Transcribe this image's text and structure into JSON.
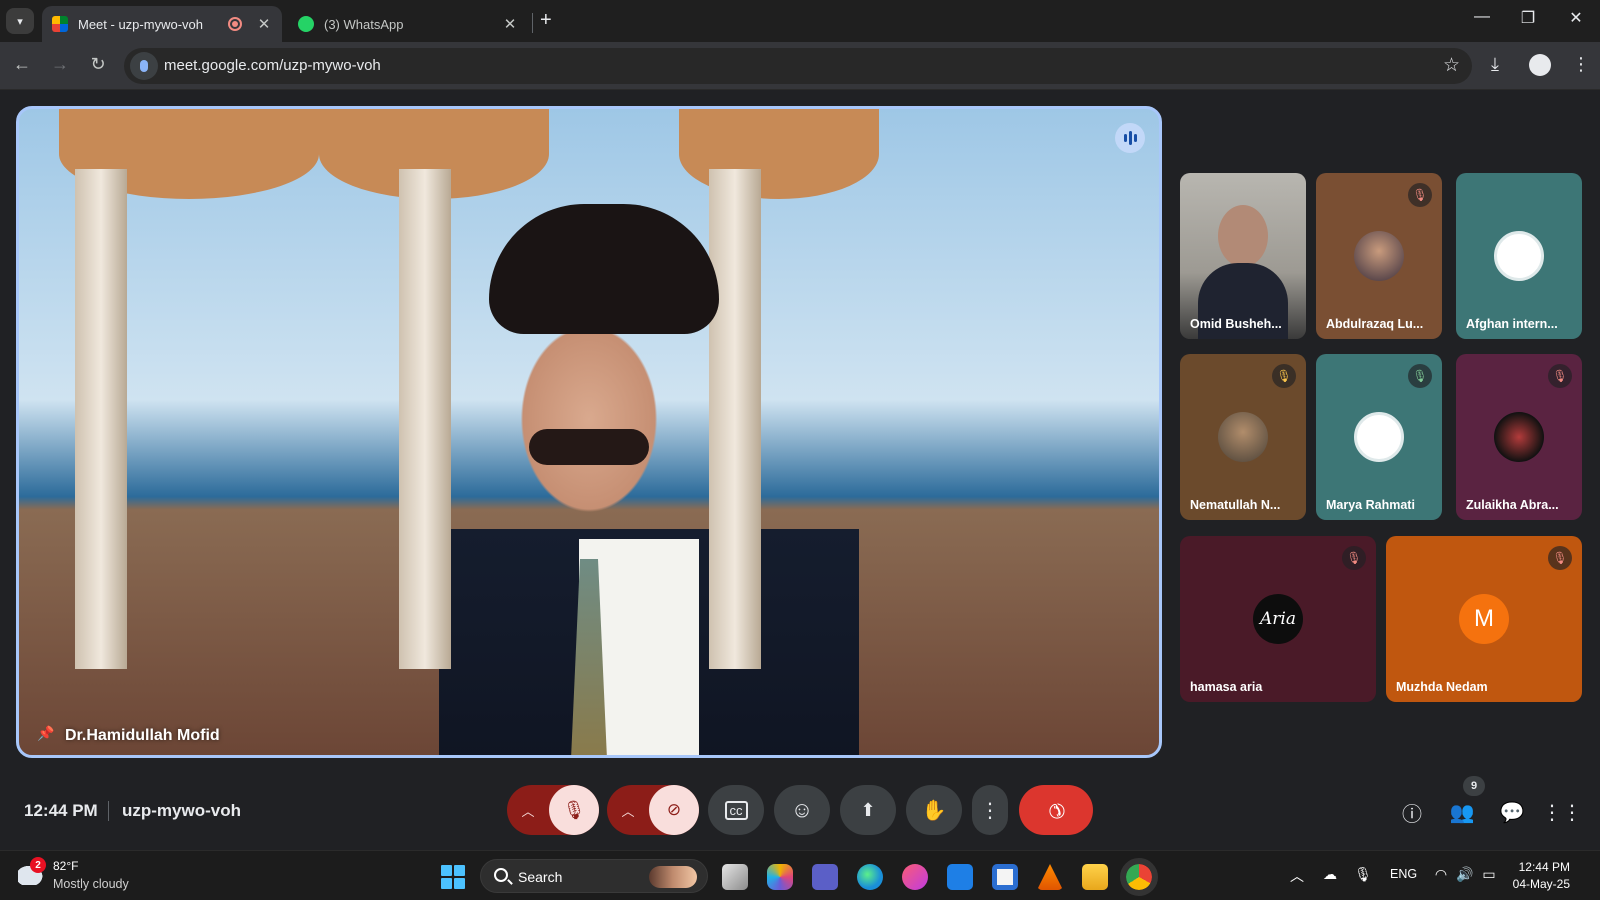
{
  "browser": {
    "tabs": [
      {
        "label": "Meet - uzp-mywo-voh",
        "active": true,
        "recording": true
      },
      {
        "label": "(3) WhatsApp",
        "active": false
      }
    ],
    "new_tab": "+",
    "url": "meet.google.com/uzp-mywo-voh",
    "window_controls": {
      "minimize": "—",
      "restore": "❐",
      "close": "✕"
    },
    "nav": {
      "back": "←",
      "forward": "→",
      "reload": "↻"
    }
  },
  "meet": {
    "main_speaker": {
      "name": "Dr.Hamidullah Mofid",
      "pinned": true
    },
    "participants": [
      {
        "name": "Omid Busheh...",
        "muted": false,
        "tile_color": "#2d2d2d",
        "avatar": "video"
      },
      {
        "name": "Abdulrazaq Lu...",
        "muted": true,
        "tile_color": "#7a4f33",
        "avatar": "photo"
      },
      {
        "name": "Afghan intern...",
        "muted": false,
        "tile_color": "#3d7676",
        "avatar": "logo"
      },
      {
        "name": "Nematullah N...",
        "muted": true,
        "tile_color": "#6b4a2c",
        "avatar": "photo"
      },
      {
        "name": "Marya Rahmati",
        "muted": true,
        "tile_color": "#3d7676",
        "avatar": "logo"
      },
      {
        "name": "Zulaikha Abra...",
        "muted": true,
        "tile_color": "#5a2341",
        "avatar": "photo"
      },
      {
        "name": "hamasa aria",
        "muted": true,
        "tile_color": "#4a1a28",
        "avatar": "Aria"
      },
      {
        "name": "Muzhda Nedam",
        "muted": true,
        "tile_color": "#c0570f",
        "avatar": "M"
      }
    ],
    "clock": "12:44 PM",
    "meeting_code": "uzp-mywo-voh",
    "people_count": "9",
    "accent_end_call": "#dc362e"
  },
  "taskbar": {
    "weather": {
      "temp": "82°F",
      "desc": "Mostly cloudy",
      "badge": "2"
    },
    "search_label": "Search",
    "language": "ENG",
    "time": "12:44 PM",
    "date": "04-May-25"
  }
}
